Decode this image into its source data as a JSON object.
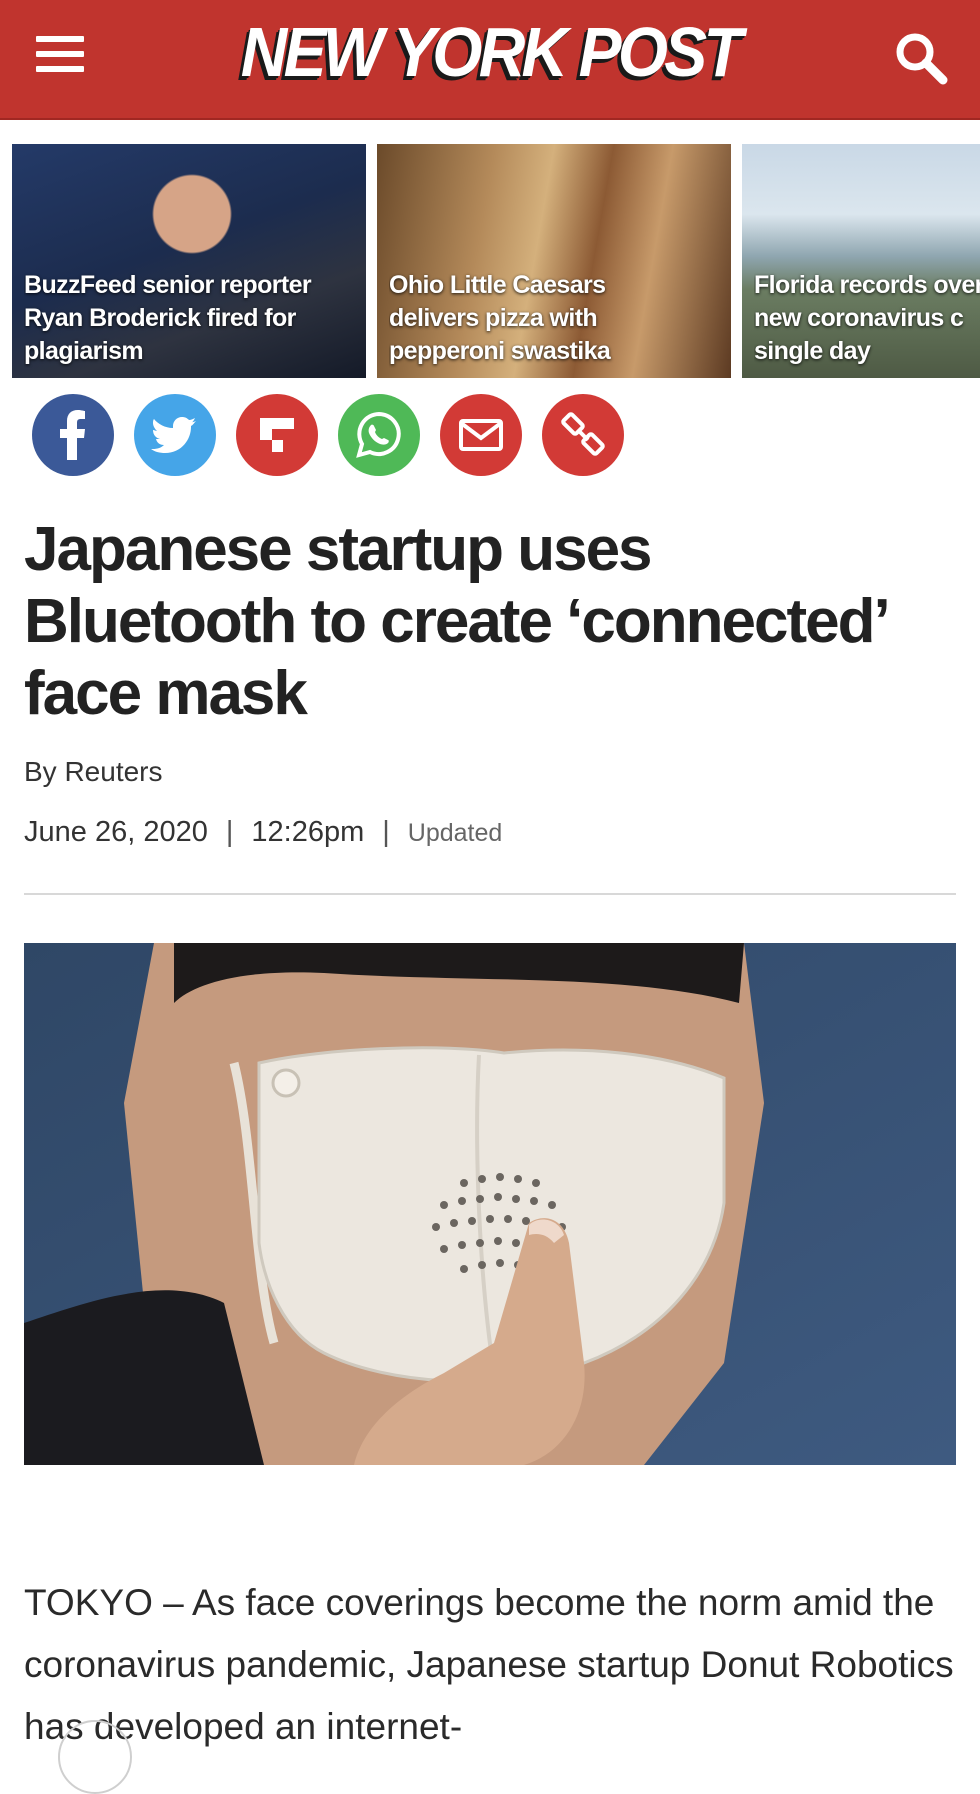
{
  "header": {
    "logo_text": "NEW YORK POST",
    "menu_icon": "hamburger-menu-icon",
    "search_icon": "search-icon",
    "background_color": "#c0342e"
  },
  "related": [
    {
      "title": "BuzzFeed senior reporter\nRyan Broderick fired for\nplagiarism"
    },
    {
      "title": "Ohio Little Caesars\ndelivers pizza with\npepperoni swastika"
    },
    {
      "title": "Florida records over\nnew coronavirus c\nsingle day"
    }
  ],
  "share": [
    {
      "icon": "facebook-icon",
      "color": "#3b5998"
    },
    {
      "icon": "twitter-icon",
      "color": "#45a5e8"
    },
    {
      "icon": "flipboard-icon",
      "color": "#d23a36"
    },
    {
      "icon": "whatsapp-icon",
      "color": "#4fb957"
    },
    {
      "icon": "email-icon",
      "color": "#d23a36"
    },
    {
      "icon": "link-icon",
      "color": "#d23a36"
    }
  ],
  "article": {
    "headline": "Japanese startup uses Bluetooth to create ‘connected’ face mask",
    "byline": "By Reuters",
    "date": "June 26, 2020",
    "sep1": "|",
    "time": "12:26pm",
    "sep2": "|",
    "updated": "Updated",
    "body": "TOKYO – As face coverings become the norm amid the coronavirus pandemic, Japanese startup Donut Robotics has developed an internet-"
  }
}
